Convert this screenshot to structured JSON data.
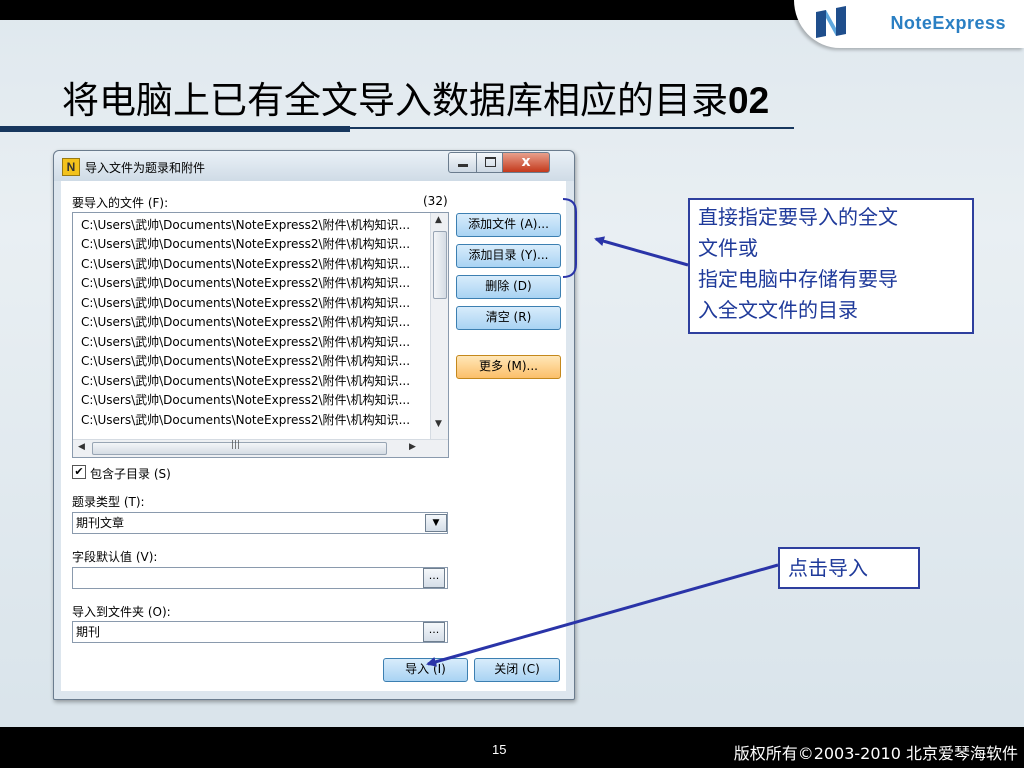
{
  "slide": {
    "title": "将电脑上已有全文导入数据库相应的目录",
    "title_number": "02",
    "page_number": "15",
    "copyright": "版权所有©2003-2010 北京爱琴海软件",
    "logo_text": "NoteExpress"
  },
  "dialog": {
    "app_icon": "N",
    "title": "导入文件为题录和附件",
    "close_glyph": "x",
    "files_label": "要导入的文件 (F):",
    "files_count": "(32)",
    "files": [
      "C:\\Users\\武帅\\Documents\\NoteExpress2\\附件\\机构知识...",
      "C:\\Users\\武帅\\Documents\\NoteExpress2\\附件\\机构知识...",
      "C:\\Users\\武帅\\Documents\\NoteExpress2\\附件\\机构知识...",
      "C:\\Users\\武帅\\Documents\\NoteExpress2\\附件\\机构知识...",
      "C:\\Users\\武帅\\Documents\\NoteExpress2\\附件\\机构知识...",
      "C:\\Users\\武帅\\Documents\\NoteExpress2\\附件\\机构知识...",
      "C:\\Users\\武帅\\Documents\\NoteExpress2\\附件\\机构知识...",
      "C:\\Users\\武帅\\Documents\\NoteExpress2\\附件\\机构知识...",
      "C:\\Users\\武帅\\Documents\\NoteExpress2\\附件\\机构知识...",
      "C:\\Users\\武帅\\Documents\\NoteExpress2\\附件\\机构知识...",
      "C:\\Users\\武帅\\Documents\\NoteExpress2\\附件\\机构知识..."
    ],
    "buttons": {
      "add_file": "添加文件 (A)...",
      "add_dir": "添加目录 (Y)...",
      "delete": "删除 (D)",
      "clear": "清空 (R)",
      "more": "更多 (M)...",
      "import": "导入 (I)",
      "close": "关闭 (C)"
    },
    "include_subdir": {
      "label": "包含子目录 (S)",
      "checked": true,
      "mark": "✔"
    },
    "record_type": {
      "label": "题录类型 (T):",
      "value": "期刊文章"
    },
    "field_default": {
      "label": "字段默认值 (V):",
      "value": ""
    },
    "import_folder": {
      "label": "导入到文件夹 (O):",
      "value": "期刊"
    },
    "ellipsis": "...",
    "scroll_mark": "|||"
  },
  "callouts": {
    "direct": [
      "直接指定要导入的全文",
      "文件或",
      "指定电脑中存储有要导",
      "入全文文件的目录"
    ],
    "click_import": "点击导入"
  },
  "colors": {
    "title_rule": "#17375e",
    "callout_border": "#2e3f9e",
    "arrow": "#2a34a8",
    "logo": "#2a7fc3"
  }
}
